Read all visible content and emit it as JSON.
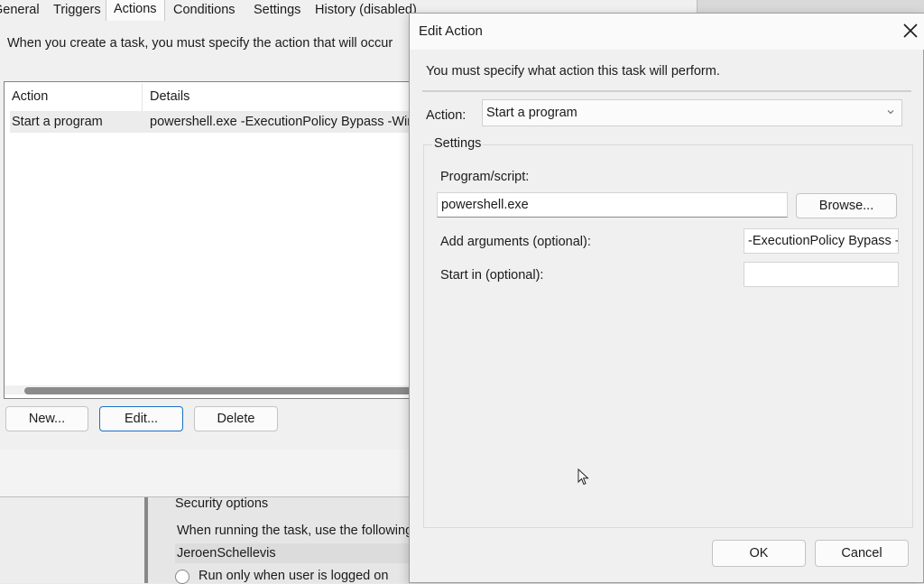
{
  "back_window": {
    "tabs": [
      {
        "label": "General"
      },
      {
        "label": "Triggers"
      },
      {
        "label": "Actions"
      },
      {
        "label": "Conditions"
      },
      {
        "label": "Settings"
      },
      {
        "label": "History (disabled)"
      }
    ],
    "active_tab": "Actions",
    "intro": "When you create a task, you must specify the action that will occur",
    "table": {
      "columns": [
        "Action",
        "Details"
      ],
      "rows": [
        {
          "action": "Start a program",
          "details": "powershell.exe -ExecutionPolicy Bypass -Window"
        }
      ]
    },
    "buttons": {
      "new": "New...",
      "edit": "Edit...",
      "delete": "Delete"
    }
  },
  "security": {
    "title": "Security options",
    "description": "When running the task, use the following user account:",
    "user": "JeroenSchellevis",
    "radio_label": "Run only when user is logged on"
  },
  "edit_dialog": {
    "title": "Edit Action",
    "close_icon": "close-icon",
    "instruction": "You must specify what action this task will perform.",
    "action_label": "Action:",
    "action_value": "Start a program",
    "settings_legend": "Settings",
    "program_label": "Program/script:",
    "program_value": "powershell.exe",
    "browse_label": "Browse...",
    "args_label": "Add arguments (optional):",
    "args_value": "-ExecutionPolicy Bypass -",
    "startin_label": "Start in (optional):",
    "startin_value": "",
    "ok_label": "OK",
    "cancel_label": "Cancel"
  }
}
